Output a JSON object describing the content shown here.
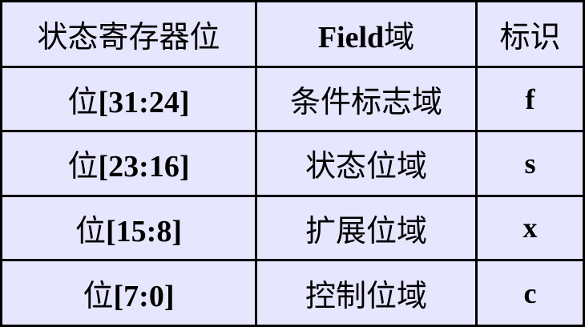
{
  "table": {
    "headers": {
      "register": "状态寄存器位",
      "field_latin": "Field",
      "field_cjk": "域",
      "flag": "标识"
    },
    "rows": [
      {
        "bit_prefix": "位",
        "bit_range": "[31:24]",
        "field": "条件标志域",
        "flag": "f"
      },
      {
        "bit_prefix": "位",
        "bit_range": "[23:16]",
        "field": "状态位域",
        "flag": "s"
      },
      {
        "bit_prefix": "位",
        "bit_range": "[15:8]",
        "field": "扩展位域",
        "flag": "x"
      },
      {
        "bit_prefix": "位",
        "bit_range": "[7:0]",
        "field": "控制位域",
        "flag": "c"
      }
    ]
  },
  "colors": {
    "cell_background": "#e6e6ff",
    "border": "#000000",
    "text": "#000000"
  }
}
